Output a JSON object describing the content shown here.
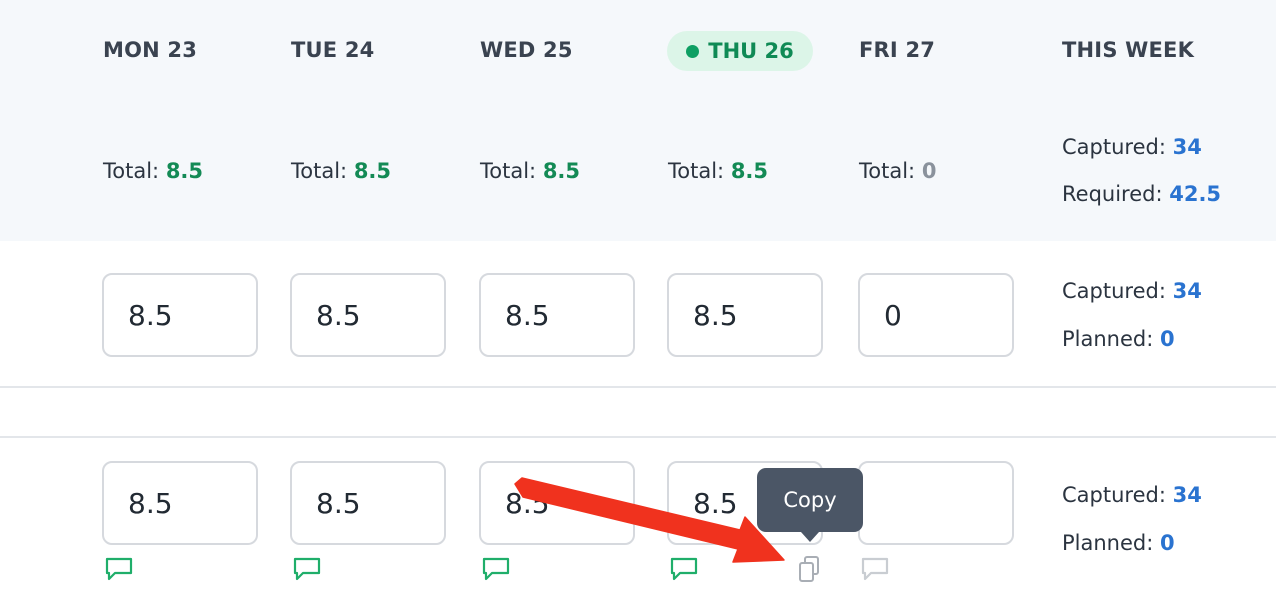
{
  "days": [
    {
      "label": "MON 23",
      "total_label": "Total:",
      "total": "8.5"
    },
    {
      "label": "TUE 24",
      "total_label": "Total:",
      "total": "8.5"
    },
    {
      "label": "WED 25",
      "total_label": "Total:",
      "total": "8.5"
    },
    {
      "label": "THU 26",
      "total_label": "Total:",
      "total": "8.5",
      "today": true
    },
    {
      "label": "FRI 27",
      "total_label": "Total:",
      "total": "0"
    }
  ],
  "this_week": {
    "label": "THIS WEEK",
    "captured_label": "Captured:",
    "captured": "34",
    "required_label": "Required:",
    "required": "42.5"
  },
  "rows": [
    {
      "values": [
        "8.5",
        "8.5",
        "8.5",
        "8.5",
        "0"
      ],
      "captured_label": "Captured:",
      "captured": "34",
      "planned_label": "Planned:",
      "planned": "0"
    },
    {
      "values": [
        "8.5",
        "8.5",
        "8.5",
        "8.5",
        ""
      ],
      "captured_label": "Captured:",
      "captured": "34",
      "planned_label": "Planned:",
      "planned": "0"
    }
  ],
  "tooltip": {
    "text": "Copy"
  },
  "colors": {
    "accent_green": "#138a55",
    "link_blue": "#2a73d0",
    "header_bg": "#f5f8fb",
    "tooltip_bg": "#4b5666",
    "annotation_arrow": "#f0321e"
  },
  "icons": [
    "comment-icon",
    "copy-icon",
    "status-dot"
  ]
}
